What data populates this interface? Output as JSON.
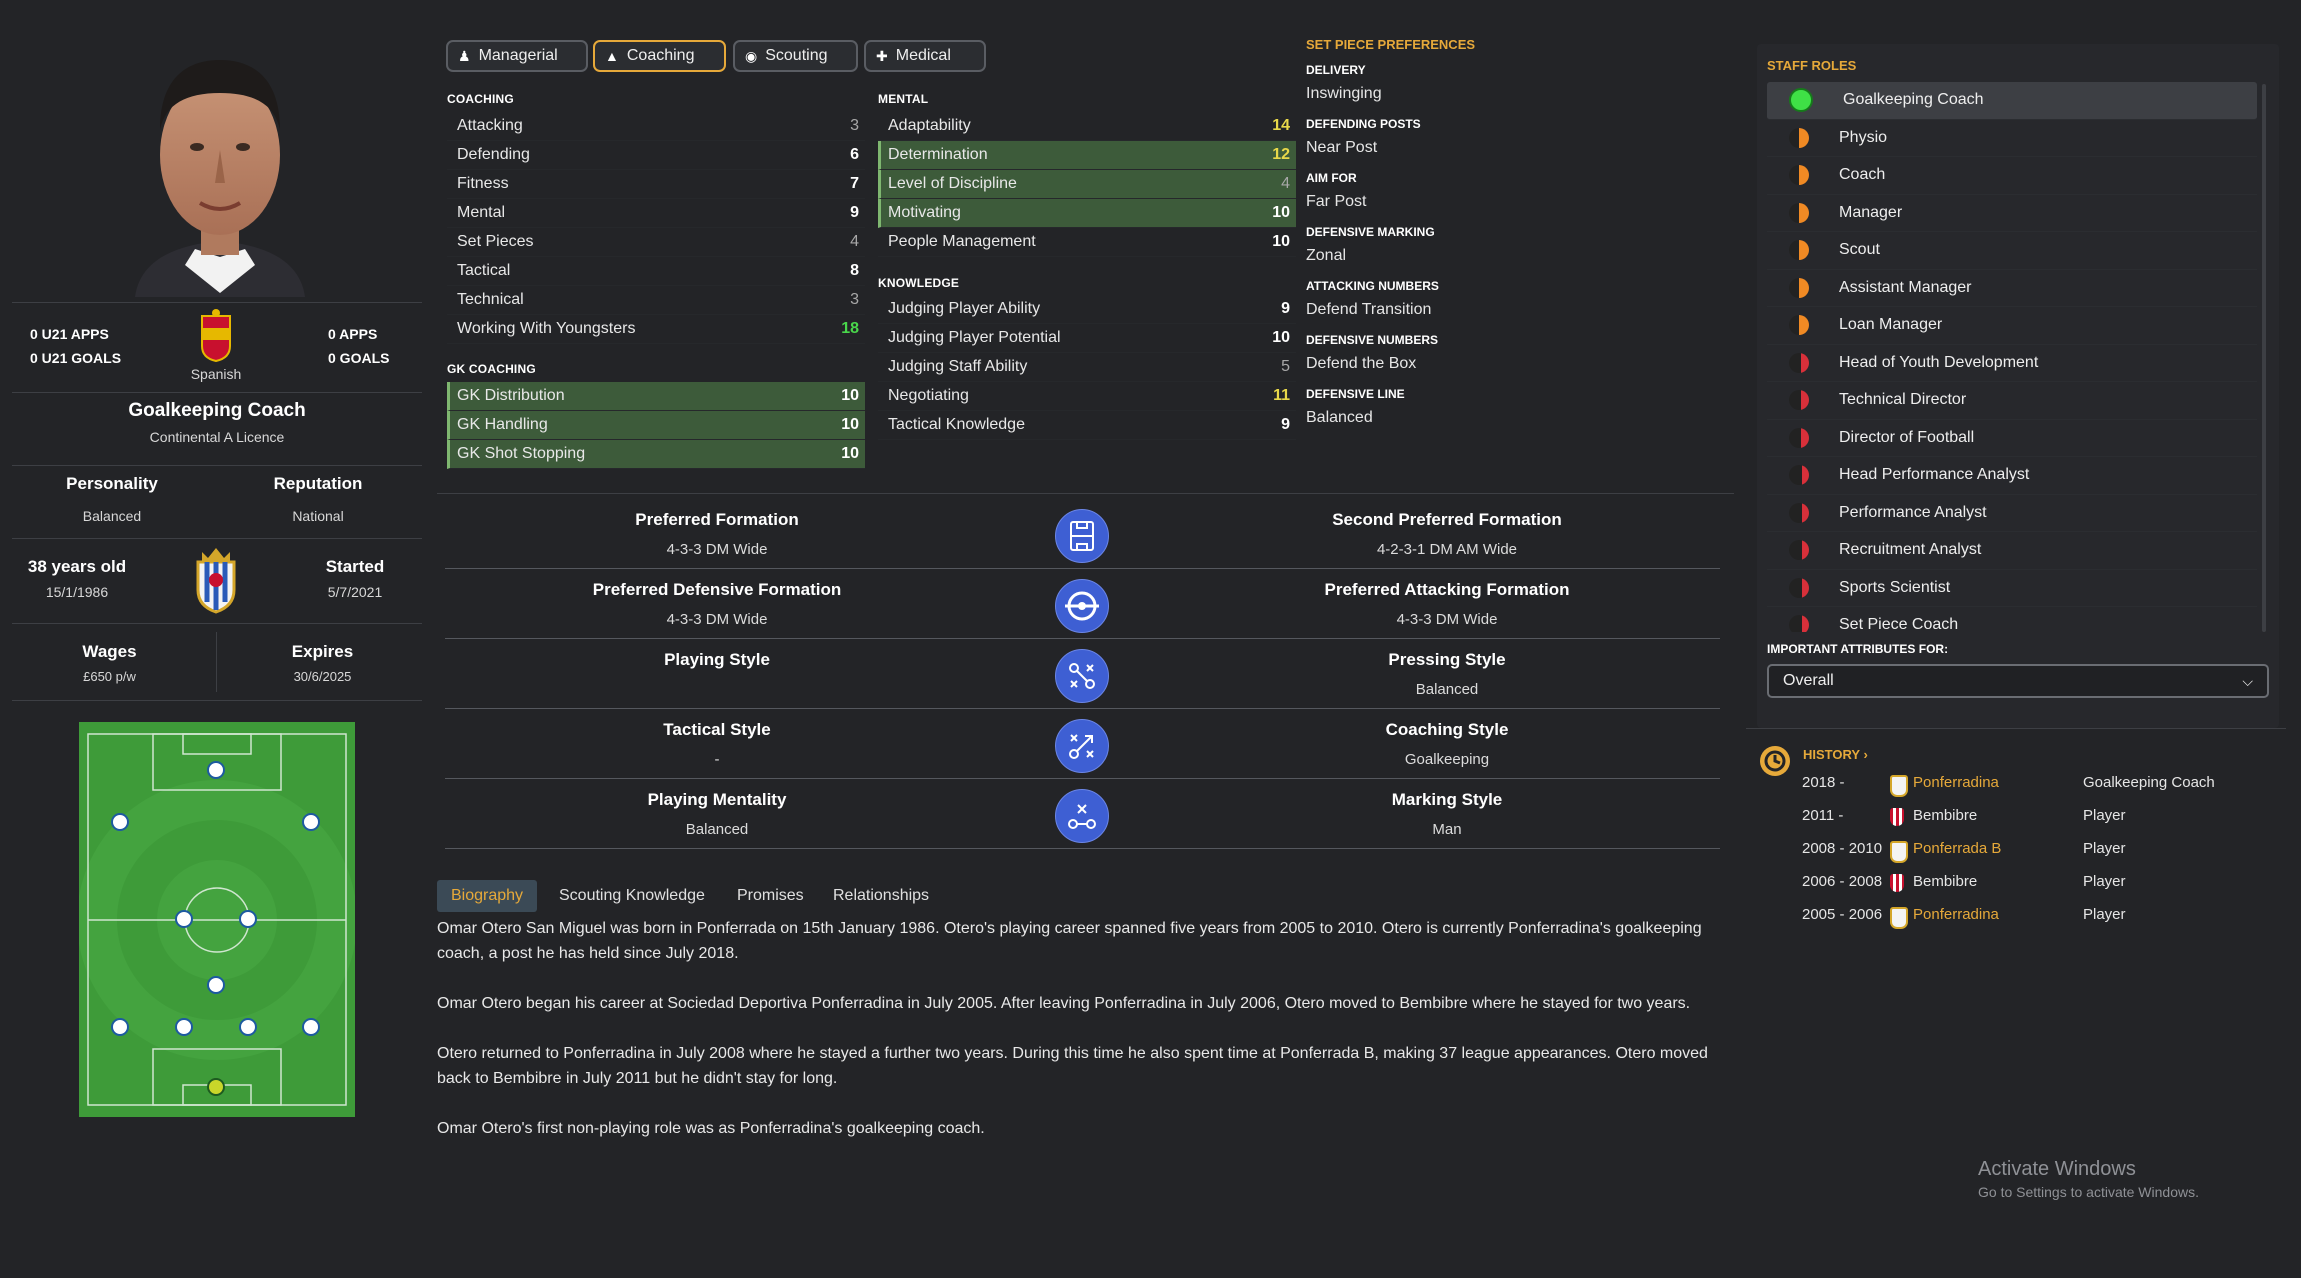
{
  "profile": {
    "u21_apps": "0 U21 APPS",
    "u21_goals": "0 U21 GOALS",
    "apps": "0 APPS",
    "goals": "0 GOALS",
    "nationality": "Spanish",
    "role": "Goalkeeping Coach",
    "licence": "Continental A Licence",
    "personality_label": "Personality",
    "personality": "Balanced",
    "reputation_label": "Reputation",
    "reputation": "National",
    "age": "38 years old",
    "dob": "15/1/1986",
    "started_label": "Started",
    "started": "5/7/2021",
    "wages_label": "Wages",
    "wages": "£650 p/w",
    "expires_label": "Expires",
    "expires": "30/6/2025"
  },
  "tabs": [
    {
      "label": "Managerial",
      "icon": "person-icon",
      "active": false
    },
    {
      "label": "Coaching",
      "icon": "cone-icon",
      "active": true
    },
    {
      "label": "Scouting",
      "icon": "binoculars-icon",
      "active": false
    },
    {
      "label": "Medical",
      "icon": "medical-kit-icon",
      "active": false
    }
  ],
  "coaching": {
    "title": "COACHING",
    "items": [
      {
        "label": "Attacking",
        "value": "3"
      },
      {
        "label": "Defending",
        "value": "6"
      },
      {
        "label": "Fitness",
        "value": "7"
      },
      {
        "label": "Mental",
        "value": "9"
      },
      {
        "label": "Set Pieces",
        "value": "4"
      },
      {
        "label": "Tactical",
        "value": "8"
      },
      {
        "label": "Technical",
        "value": "3"
      },
      {
        "label": "Working With Youngsters",
        "value": "18"
      }
    ]
  },
  "gk_coaching": {
    "title": "GK COACHING",
    "items": [
      {
        "label": "GK Distribution",
        "value": "10"
      },
      {
        "label": "GK Handling",
        "value": "10"
      },
      {
        "label": "GK Shot Stopping",
        "value": "10"
      }
    ]
  },
  "mental": {
    "title": "MENTAL",
    "items": [
      {
        "label": "Adaptability",
        "value": "14"
      },
      {
        "label": "Determination",
        "value": "12"
      },
      {
        "label": "Level of Discipline",
        "value": "4"
      },
      {
        "label": "Motivating",
        "value": "10"
      },
      {
        "label": "People Management",
        "value": "10"
      }
    ]
  },
  "knowledge": {
    "title": "KNOWLEDGE",
    "items": [
      {
        "label": "Judging Player Ability",
        "value": "9"
      },
      {
        "label": "Judging Player Potential",
        "value": "10"
      },
      {
        "label": "Judging Staff Ability",
        "value": "5"
      },
      {
        "label": "Negotiating",
        "value": "11"
      },
      {
        "label": "Tactical Knowledge",
        "value": "9"
      }
    ]
  },
  "set_piece": {
    "title": "SET PIECE PREFERENCES",
    "items": [
      {
        "heading": "DELIVERY",
        "value": "Inswinging"
      },
      {
        "heading": "DEFENDING POSTS",
        "value": "Near Post"
      },
      {
        "heading": "AIM FOR",
        "value": "Far Post"
      },
      {
        "heading": "DEFENSIVE MARKING",
        "value": "Zonal"
      },
      {
        "heading": "ATTACKING NUMBERS",
        "value": "Defend Transition"
      },
      {
        "heading": "DEFENSIVE NUMBERS",
        "value": "Defend the Box"
      },
      {
        "heading": "DEFENSIVE LINE",
        "value": "Balanced"
      }
    ]
  },
  "formations": {
    "rows": [
      {
        "left_title": "Preferred Formation",
        "left_value": "4-3-3 DM Wide",
        "icon": "formation-pitch-icon",
        "right_title": "Second Preferred Formation",
        "right_value": "4-2-3-1 DM AM Wide"
      },
      {
        "left_title": "Preferred Defensive Formation",
        "left_value": "4-3-3 DM Wide",
        "icon": "target-icon",
        "right_title": "Preferred Attacking Formation",
        "right_value": "4-3-3 DM Wide"
      },
      {
        "left_title": "Playing Style",
        "left_value": "",
        "icon": "tactics-icon",
        "right_title": "Pressing Style",
        "right_value": "Balanced"
      },
      {
        "left_title": "Tactical Style",
        "left_value": "-",
        "icon": "arrows-icon",
        "right_title": "Coaching Style",
        "right_value": "Goalkeeping"
      },
      {
        "left_title": "Playing Mentality",
        "left_value": "Balanced",
        "icon": "mentality-icon",
        "right_title": "Marking Style",
        "right_value": "Man"
      }
    ]
  },
  "bottom_tabs": [
    {
      "label": "Biography",
      "active": true
    },
    {
      "label": "Scouting Knowledge",
      "active": false
    },
    {
      "label": "Promises",
      "active": false
    },
    {
      "label": "Relationships",
      "active": false
    }
  ],
  "biography": [
    "Omar Otero San Miguel was born in Ponferrada on 15th January 1986. Otero's playing career spanned five years from 2005 to 2010. Otero is currently Ponferradina's goalkeeping coach, a post he has held since July 2018.",
    "Omar Otero began his career at Sociedad Deportiva Ponferradina in July 2005. After leaving Ponferradina in July 2006, Otero moved to Bembibre where he stayed for two years.",
    "Otero returned to Ponferradina in July 2008 where he stayed a further two years. During this time he also spent time at Ponferrada B, making 37 league appearances. Otero moved back to Bembibre in July 2011 but he didn't stay for long.",
    "Omar Otero's first non-playing role was as Ponferradina's goalkeeping coach."
  ],
  "staff_roles": {
    "title": "STAFF ROLES",
    "items": [
      {
        "label": "Goalkeeping Coach",
        "level": "full",
        "selected": true
      },
      {
        "label": "Physio",
        "level": "half",
        "selected": false
      },
      {
        "label": "Coach",
        "level": "half",
        "selected": false
      },
      {
        "label": "Manager",
        "level": "half",
        "selected": false
      },
      {
        "label": "Scout",
        "level": "half",
        "selected": false
      },
      {
        "label": "Assistant Manager",
        "level": "half",
        "selected": false
      },
      {
        "label": "Loan Manager",
        "level": "half",
        "selected": false
      },
      {
        "label": "Head of Youth Development",
        "level": "low",
        "selected": false
      },
      {
        "label": "Technical Director",
        "level": "low",
        "selected": false
      },
      {
        "label": "Director of Football",
        "level": "low",
        "selected": false
      },
      {
        "label": "Head Performance Analyst",
        "level": "low",
        "selected": false
      },
      {
        "label": "Performance Analyst",
        "level": "low",
        "selected": false
      },
      {
        "label": "Recruitment Analyst",
        "level": "low",
        "selected": false
      },
      {
        "label": "Sports Scientist",
        "level": "low",
        "selected": false
      },
      {
        "label": "Set Piece Coach",
        "level": "low",
        "selected": false
      }
    ],
    "important_label": "IMPORTANT ATTRIBUTES FOR:",
    "important_value": "Overall"
  },
  "history": {
    "title": "HISTORY",
    "rows": [
      {
        "years": "2018 -",
        "club": "Ponferradina",
        "role": "Goalkeeping Coach",
        "highlight": true,
        "crest": "ponferradina"
      },
      {
        "years": "2011 -",
        "club": "Bembibre",
        "role": "Player",
        "highlight": false,
        "crest": "bembibre"
      },
      {
        "years": "2008 - 2010",
        "club": "Ponferrada B",
        "role": "Player",
        "highlight": true,
        "crest": "ponferradina"
      },
      {
        "years": "2006 - 2008",
        "club": "Bembibre",
        "role": "Player",
        "highlight": false,
        "crest": "bembibre"
      },
      {
        "years": "2005 - 2006",
        "club": "Ponferradina",
        "role": "Player",
        "highlight": true,
        "crest": "ponferradina"
      }
    ]
  },
  "watermark": {
    "title": "Activate Windows",
    "subtitle": "Go to Settings to activate Windows."
  },
  "colors": {
    "accent": "#e6a93a",
    "green_value": "#49d64b",
    "yellow_value": "#e8d84a",
    "highlight_row": "#3d5b3a",
    "icon_blue": "#3e5fd3"
  }
}
